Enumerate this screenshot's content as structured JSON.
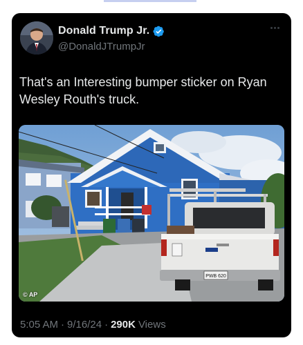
{
  "tweet": {
    "author": {
      "name": "Donald Trump Jr.",
      "handle": "@DonaldJTrumpJr",
      "verified": true,
      "avatar": "avatar"
    },
    "text": "That's an Interesting bumper sticker on Ryan Wesley Routh's truck.",
    "media": {
      "alt_icon": "photo-truck-house",
      "credit": "AP",
      "plate_text": "PWB 620"
    },
    "meta": {
      "time": "5:05 AM",
      "separator": "·",
      "date": "9/16/24",
      "views_count": "290K",
      "views_label": "Views"
    }
  },
  "colors": {
    "background": "#000000",
    "text_primary": "#e7e9ea",
    "text_secondary": "#71767b",
    "verified_blue": "#1d9bf0"
  }
}
